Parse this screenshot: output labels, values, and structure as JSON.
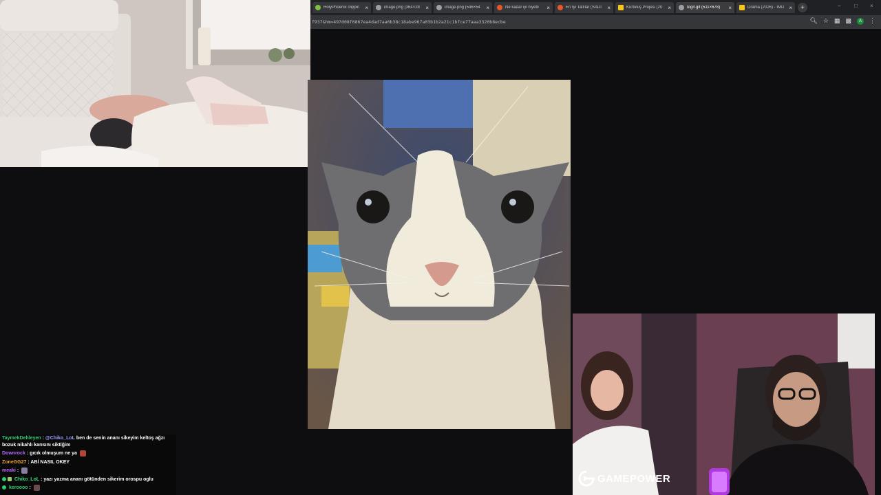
{
  "browser": {
    "tabs": [
      {
        "label": "HolyPhoenix clippin",
        "favicon_color": "#7fbf3f",
        "active": false
      },
      {
        "label": "image.png (364×28",
        "favicon_color": "#9aa0a6",
        "active": false
      },
      {
        "label": "image.png (546×54",
        "favicon_color": "#9aa0a6",
        "active": false
      },
      {
        "label": "Ne kadar iyi niyetli",
        "favicon_color": "#e8572a",
        "active": false
      },
      {
        "label": "En İyi Tatlılar (SADI",
        "favicon_color": "#e8572a",
        "active": false
      },
      {
        "label": "Kurtuluş Projesi (20",
        "favicon_color": "#f5c518",
        "active": false
      },
      {
        "label": "togif.gif (511×678)",
        "favicon_color": "#9aa0a6",
        "active": true
      },
      {
        "label": "Drama (2026) - IMD",
        "favicon_color": "#f5c518",
        "active": false
      }
    ],
    "close_glyph": "×",
    "new_tab_glyph": "+",
    "url": "f937&hm=497d08f6867ea4dad7aa6b38c18abe967a03b1b2a21c1bfce77aaa3320b8ecbe",
    "profile_initial": "A",
    "icons": [
      "zoom-icon",
      "star-icon",
      "extensions-icon",
      "cast-icon",
      "profile-avatar",
      "menu-icon"
    ]
  },
  "watermark": {
    "part1": "GAME",
    "part2": "POWER"
  },
  "chat": {
    "messages": [
      {
        "user": "TaymekDehleyen",
        "color": "#2ecc71",
        "mention": "@Chiko_LoL",
        "text": "ben de senin ananı sikeyim keltoş ağzı bozuk nikahlı karısını siktiğim",
        "emote": ""
      },
      {
        "user": "Downrock",
        "color": "#b36bff",
        "mention": "",
        "text": "gıcık olmuşum ne ya",
        "emote": "#b0453a"
      },
      {
        "user": "ZoneGG27",
        "color": "#f0a830",
        "mention": "",
        "text": "ABİ NASIL OKEY",
        "emote": ""
      },
      {
        "user": "meaki",
        "color": "#c06bff",
        "mention": "",
        "text": "",
        "emote": "#8a7fa0"
      },
      {
        "user": "Chiko_LoL",
        "color": "#3ddc84",
        "mention": "",
        "text": "yazı yazma ananı götünden sikerim orospu oglu",
        "emote": ""
      },
      {
        "user": "keroooo",
        "color": "#2ecc71",
        "mention": "",
        "text": "",
        "emote": "#6a4a4a"
      }
    ]
  }
}
